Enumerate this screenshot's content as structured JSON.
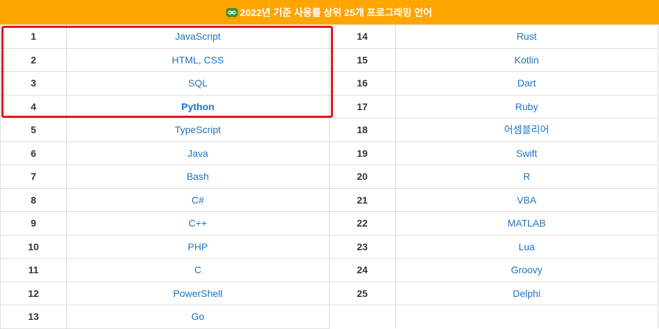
{
  "header": {
    "icon": "link-icon",
    "title": "2022년 기준 사용률 상위 25개 프로그래밍 언어"
  },
  "colors": {
    "header_bg": "#ffa500",
    "link": "#1e73be",
    "highlight_border": "#e8131c"
  },
  "table": {
    "rows": [
      {
        "left_rank": "1",
        "left_lang": "JavaScript",
        "right_rank": "14",
        "right_lang": "Rust"
      },
      {
        "left_rank": "2",
        "left_lang": "HTML, CSS",
        "right_rank": "15",
        "right_lang": "Kotlin"
      },
      {
        "left_rank": "3",
        "left_lang": "SQL",
        "right_rank": "16",
        "right_lang": "Dart"
      },
      {
        "left_rank": "4",
        "left_lang": "Python",
        "right_rank": "17",
        "right_lang": "Ruby"
      },
      {
        "left_rank": "5",
        "left_lang": "TypeScript",
        "right_rank": "18",
        "right_lang": "어셈블리어"
      },
      {
        "left_rank": "6",
        "left_lang": "Java",
        "right_rank": "19",
        "right_lang": "Swift"
      },
      {
        "left_rank": "7",
        "left_lang": "Bash",
        "right_rank": "20",
        "right_lang": "R"
      },
      {
        "left_rank": "8",
        "left_lang": "C#",
        "right_rank": "21",
        "right_lang": "VBA"
      },
      {
        "left_rank": "9",
        "left_lang": "C++",
        "right_rank": "22",
        "right_lang": "MATLAB"
      },
      {
        "left_rank": "10",
        "left_lang": "PHP",
        "right_rank": "23",
        "right_lang": "Lua"
      },
      {
        "left_rank": "11",
        "left_lang": "C",
        "right_rank": "24",
        "right_lang": "Groovy"
      },
      {
        "left_rank": "12",
        "left_lang": "PowerShell",
        "right_rank": "25",
        "right_lang": "Delphi"
      },
      {
        "left_rank": "13",
        "left_lang": "Go",
        "right_rank": "",
        "right_lang": ""
      }
    ]
  }
}
